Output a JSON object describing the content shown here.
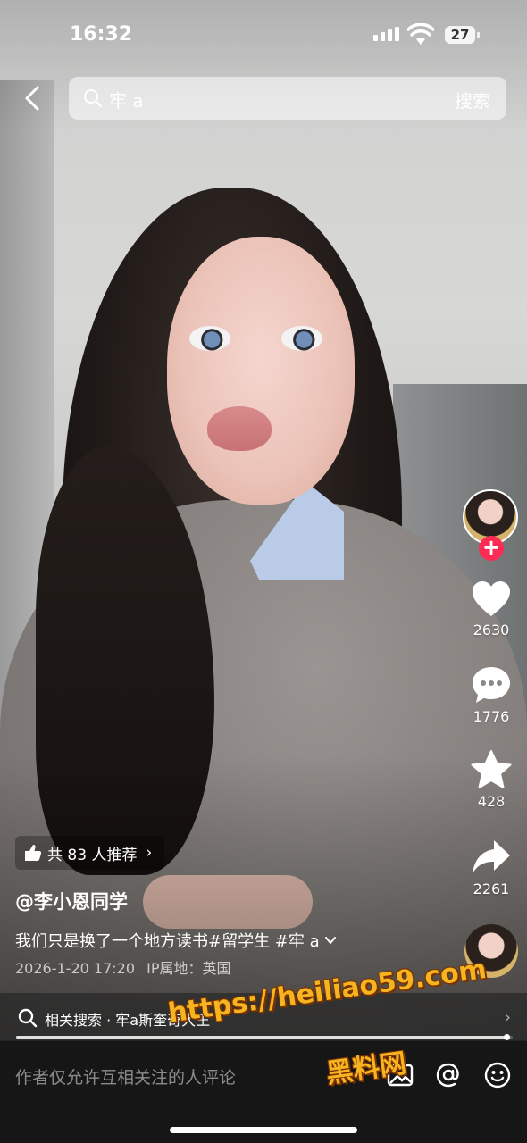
{
  "status_bar": {
    "time": "16:32",
    "battery": "27"
  },
  "search": {
    "query": "牢 a",
    "button_label": "搜索"
  },
  "right_rail": {
    "like_count": "2630",
    "comment_count": "1776",
    "favorite_count": "428",
    "share_count": "2261"
  },
  "video_info": {
    "recommend_label": "共 83 人推荐",
    "author": "@李小恩同学",
    "description": "我们只是换了一个地方读书#留学生 #牢 a",
    "date": "2026-1-20 17:20",
    "ip_location": "IP属地：英国"
  },
  "related_search": {
    "label": "相关搜索 · 牢a斯奎奇大王"
  },
  "playback": {
    "progress": 0.99
  },
  "comment_bar": {
    "placeholder": "作者仅允许互相关注的人评论"
  },
  "watermark": {
    "url": "https://heiliao59.com",
    "name": "黑料网"
  },
  "colors": {
    "follow_accent": "#fe2c55",
    "watermark": "#f6b420"
  }
}
